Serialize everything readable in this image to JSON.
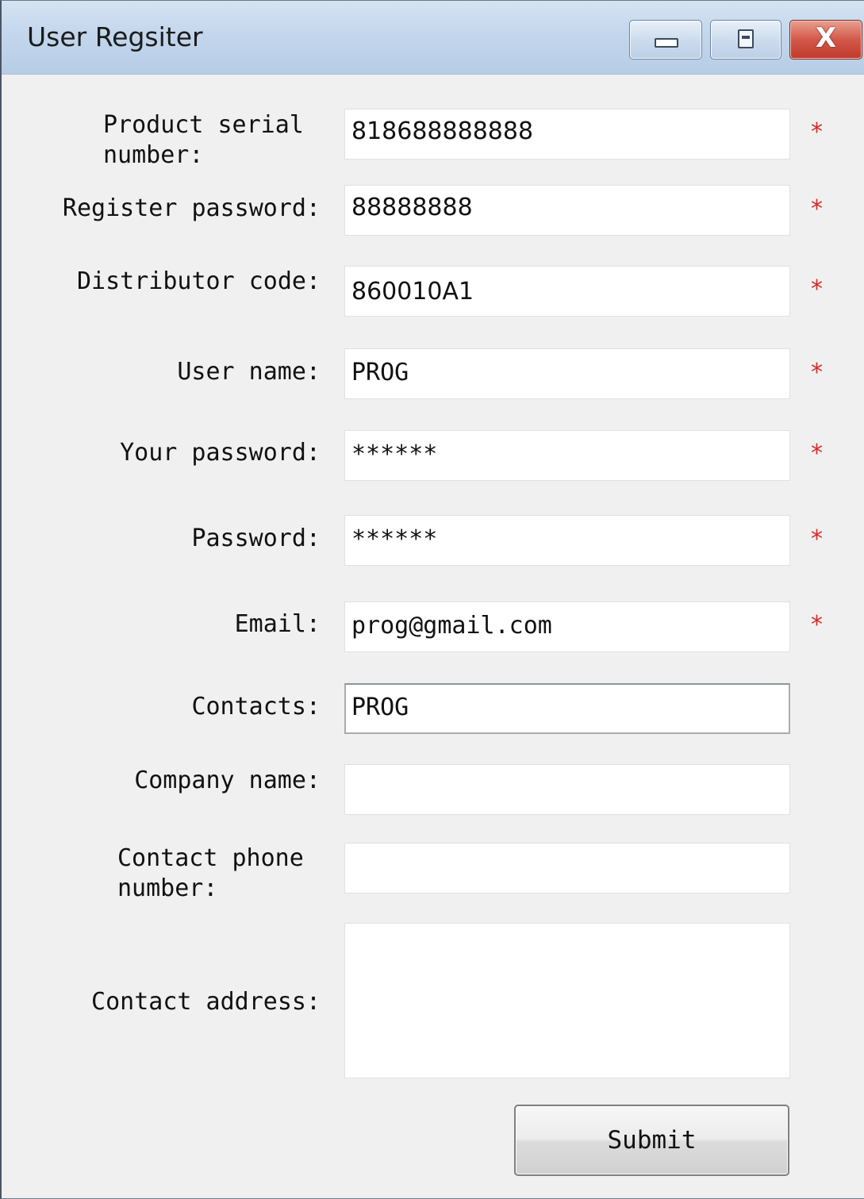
{
  "window": {
    "title": "User Regsiter",
    "controls": {
      "minimize": "minimize",
      "maximize": "maximize",
      "close": "X"
    }
  },
  "form": {
    "product_serial": {
      "label": "Product serial\nnumber:",
      "value": "818688888888",
      "required": "*"
    },
    "register_password": {
      "label": "Register password:",
      "value": "88888888",
      "required": "*"
    },
    "distributor_code": {
      "label": "Distributor code:",
      "value": "860010A1",
      "required": "*"
    },
    "user_name": {
      "label": "User name:",
      "value": "PROG",
      "required": "*"
    },
    "your_password": {
      "label": "Your password:",
      "value": "******",
      "required": "*"
    },
    "password": {
      "label": "Password:",
      "value": "******",
      "required": "*"
    },
    "email": {
      "label": "Email:",
      "value": "prog@gmail.com",
      "required": "*"
    },
    "contacts": {
      "label": "Contacts:",
      "value": "PROG"
    },
    "company_name": {
      "label": "Company name:",
      "value": ""
    },
    "contact_phone": {
      "label": "Contact phone\nnumber:",
      "value": ""
    },
    "contact_address": {
      "label": "Contact address:",
      "value": ""
    }
  },
  "submit_label": "Submit",
  "colors": {
    "required_marker": "#d52a2a",
    "titlebar": "#c3d6ec",
    "window_bg": "#f0f0f0"
  },
  "icons": {
    "minimize": "minimize-icon",
    "maximize": "maximize-icon",
    "close": "close-icon"
  }
}
